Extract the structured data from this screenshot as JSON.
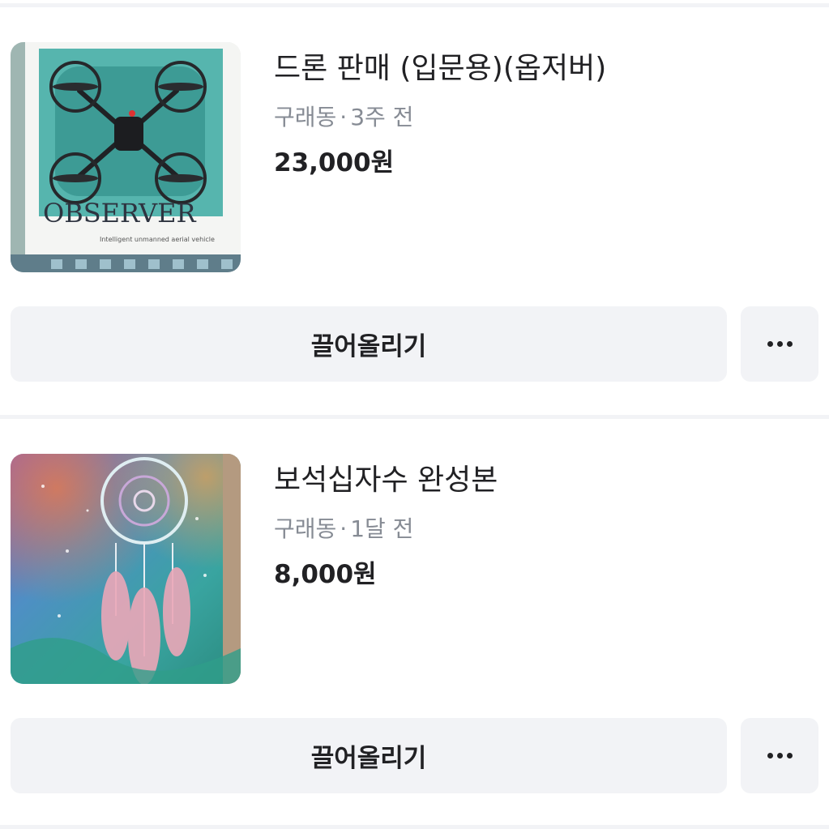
{
  "items": [
    {
      "title": "드론 판매 (입문용)(옵저버)",
      "location": "구래동",
      "time": "3주 전",
      "price": "23,000원",
      "thumbnail_text": "OBSERVER",
      "bump_label": "끌어올리기",
      "more_icon": "more-horizontal-icon"
    },
    {
      "title": "보석십자수 완성본",
      "location": "구래동",
      "time": "1달 전",
      "price": "8,000원",
      "bump_label": "끌어올리기",
      "more_icon": "more-horizontal-icon"
    }
  ]
}
